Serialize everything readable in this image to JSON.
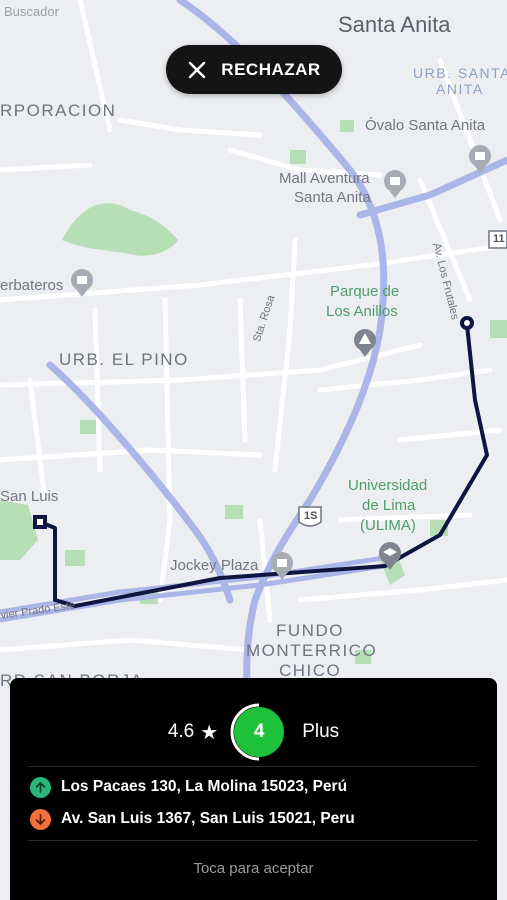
{
  "status_bar": {
    "carrier": "Buscador"
  },
  "map": {
    "labels": {
      "santa_anita": "Santa Anita",
      "urb_santa_anita": "URB. SANTA",
      "urb_santa_anita_2": "ANITA",
      "corporacion": "RPORACION",
      "ovalo": "Óvalo Santa Anita",
      "mall_1": "Mall Aventura",
      "mall_2": "Santa Anita",
      "yerbateros": "erbateros",
      "parque_1": "Parque de",
      "parque_2": "Los Anillos",
      "urb_pino": "URB. EL PINO",
      "sta_rosa": "Sta. Rosa",
      "frutales": "Av. Los Frutales",
      "universidad_1": "Universidad",
      "universidad_2": "de Lima",
      "universidad_3": "(ULIMA)",
      "san_luis": "San Luis",
      "jockey": "Jockey Plaza",
      "javier_prado": "vier Prado Este",
      "fundo_1": "FUNDO",
      "fundo_2": "MONTERRICO",
      "fundo_3": "CHICO",
      "san_borja": "RD SAN BORJA",
      "shield_1s": "1S",
      "shield_11": "11"
    }
  },
  "reject_button": {
    "label": "RECHAZAR",
    "icon": "close-icon"
  },
  "trip_card": {
    "rating": "4.6",
    "star_icon": "★",
    "level": "4",
    "category": "Plus",
    "pickup": {
      "address": "Los Pacaes 130, La Molina 15023, Perú",
      "icon": "arrow-up-icon",
      "color": "#2ab57d"
    },
    "dropoff": {
      "address": "Av. San Luis 1367, San Luis 15021, Peru",
      "icon": "arrow-down-icon",
      "color": "#f0703a"
    },
    "accept_hint": "Toca para aceptar"
  },
  "colors": {
    "route": "#0e1540",
    "level_ring": "#1dc13a",
    "card_bg": "#000000"
  }
}
